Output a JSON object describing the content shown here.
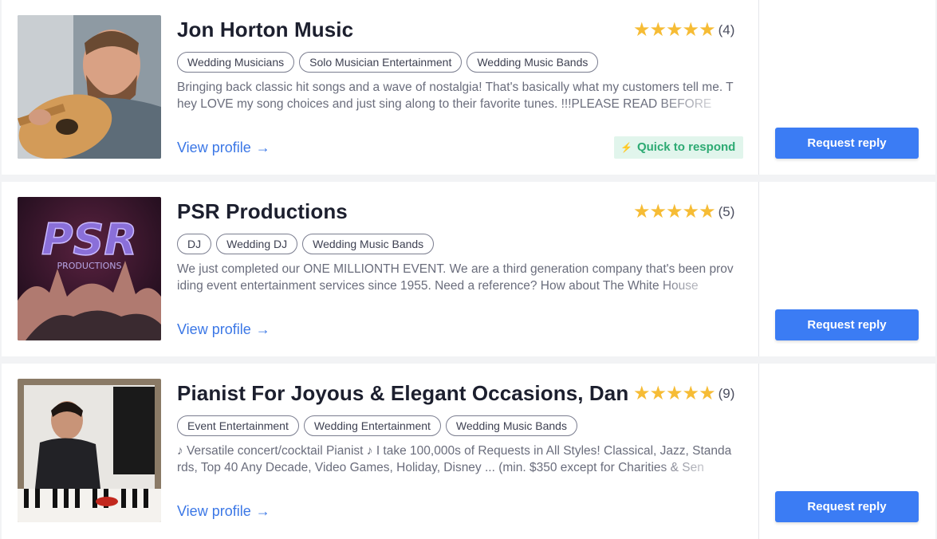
{
  "listings": [
    {
      "name": "Jon Horton Music",
      "stars": "★★★★★",
      "rating": 5,
      "review_count": "(4)",
      "tags": [
        "Wedding Musicians",
        "Solo Musician Entertainment",
        "Wedding Music Bands"
      ],
      "description": "Bringing back classic hit songs and a wave of nostalgia! That's basically what my customers tell me. They LOVE my song choices and just sing along to their favorite tunes. !!!PLEASE READ BEFORE",
      "view_profile": "View profile",
      "badge": "Quick to respond",
      "request_button": "Request reply"
    },
    {
      "name": "PSR Productions",
      "stars": "★★★★★",
      "rating": 5,
      "review_count": "(5)",
      "tags": [
        "DJ",
        "Wedding DJ",
        "Wedding Music Bands"
      ],
      "description": "We just completed our ONE MILLIONTH EVENT. We are a third generation company that's been providing event entertainment services since 1955. Need a reference? How about The White House",
      "view_profile": "View profile",
      "request_button": "Request reply",
      "photo_logo": "PSR",
      "photo_logo_sub": "PRODUCTIONS"
    },
    {
      "name": "Pianist For Joyous & Elegant Occasions, Dan Fo",
      "stars": "★★★★★",
      "rating": 5,
      "review_count": "(9)",
      "tags": [
        "Event Entertainment",
        "Wedding Entertainment",
        "Wedding Music Bands"
      ],
      "description": "♪ Versatile concert/cocktail Pianist ♪ I take 100,000s of Requests in All Styles! Classical, Jazz, Standards, Top 40 Any Decade, Video Games, Holiday, Disney ... (min. $350 except for Charities & Sen",
      "view_profile": "View profile",
      "request_button": "Request reply"
    }
  ],
  "colors": {
    "accent_blue": "#3b7cf4",
    "link_blue": "#3b77e6",
    "star_gold": "#f6bc35",
    "quick_green": "#2daa73",
    "quick_bg": "#e1f5ec"
  },
  "icons": {
    "arrow": "→",
    "bolt": "⚡"
  }
}
